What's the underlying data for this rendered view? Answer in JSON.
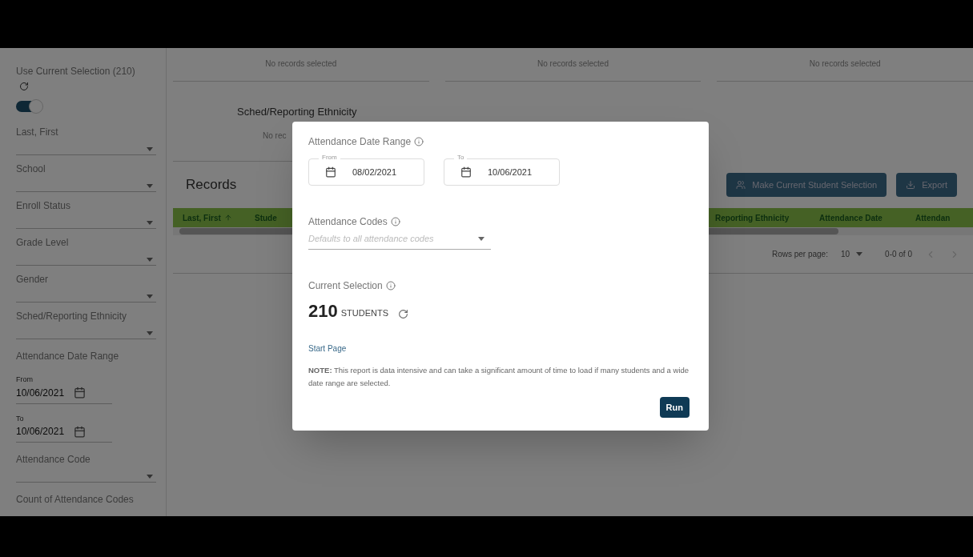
{
  "sidebar": {
    "current_selection_label": "Use Current Selection (210)",
    "use_current_selection": true,
    "filters": [
      {
        "kind": "dropdown",
        "label": "Last, First"
      },
      {
        "kind": "dropdown",
        "label": "School"
      },
      {
        "kind": "dropdown",
        "label": "Enroll Status"
      },
      {
        "kind": "dropdown",
        "label": "Grade Level"
      },
      {
        "kind": "dropdown",
        "label": "Gender"
      },
      {
        "kind": "dropdown",
        "label": "Sched/Reporting Ethnicity"
      },
      {
        "kind": "heading",
        "label": "Attendance Date Range"
      },
      {
        "kind": "date",
        "label": "From",
        "value": "10/06/2021"
      },
      {
        "kind": "date",
        "label": "To",
        "value": "10/06/2021"
      },
      {
        "kind": "dropdown",
        "label": "Attendance Code"
      },
      {
        "kind": "heading",
        "label": "Count of Attendance Codes"
      }
    ]
  },
  "selection_panels": [
    "No records selected",
    "No records selected",
    "No records selected"
  ],
  "ethnicity_panel": {
    "title": "Sched/Reporting Ethnicity",
    "text": "No rec"
  },
  "records": {
    "title": "Records",
    "buttons": [
      {
        "kind": "people",
        "label": "Make Current Student Selection"
      },
      {
        "kind": "download",
        "label": "Export"
      }
    ],
    "columns_left": [
      {
        "label": "Last, First",
        "sorted": true
      },
      {
        "label": "Stude",
        "sorted": false
      }
    ],
    "columns_right": [
      {
        "label": "Reporting Ethnicity",
        "sorted": false
      },
      {
        "label": "Attendance Date",
        "sorted": false
      },
      {
        "label": "Attendan",
        "sorted": false
      }
    ],
    "pagination": {
      "rows_label": "Rows per page:",
      "rows_value": "10",
      "range": "0-0 of 0"
    }
  },
  "dialog": {
    "date_range_label": "Attendance Date Range",
    "from": {
      "label": "From",
      "value": "08/02/2021"
    },
    "to": {
      "label": "To",
      "value": "10/06/2021"
    },
    "codes_label": "Attendance Codes",
    "codes_placeholder": "Defaults to all attendance codes",
    "selection_label": "Current Selection",
    "count": "210",
    "count_unit": "STUDENTS",
    "link": "Start Page",
    "note": "**NOTE:** This report is data intensive and can take a significant amount of time to load if many students and a wide date range are selected.",
    "run": "Run"
  }
}
